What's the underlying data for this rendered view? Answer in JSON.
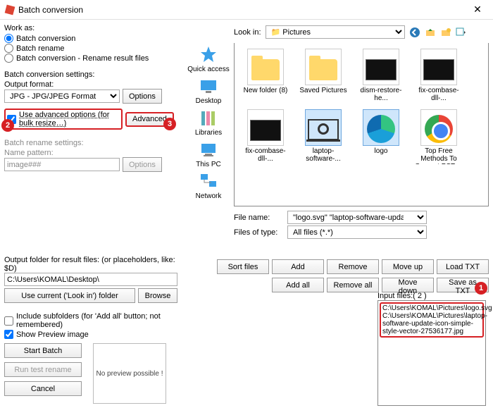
{
  "window": {
    "title": "Batch conversion"
  },
  "work_as": {
    "label": "Work as:",
    "options": [
      {
        "label": "Batch conversion",
        "checked": true
      },
      {
        "label": "Batch rename",
        "checked": false
      },
      {
        "label": "Batch conversion - Rename result files",
        "checked": false
      }
    ]
  },
  "batch_settings": {
    "heading": "Batch conversion settings:",
    "output_format_label": "Output format:",
    "output_format_value": "JPG - JPG/JPEG Format",
    "options_btn": "Options",
    "advanced_check": "Use advanced options (for bulk resize…)",
    "advanced_btn": "Advanced"
  },
  "rename_settings": {
    "heading": "Batch rename settings:",
    "name_pattern_label": "Name pattern:",
    "name_pattern_value": "image###",
    "options_btn": "Options"
  },
  "output_folder": {
    "label": "Output folder for result files: (or placeholders, like: $D)",
    "path": "C:\\Users\\KOMAL\\Desktop\\",
    "use_current_btn": "Use current ('Look in') folder",
    "browse_btn": "Browse",
    "include_sub": "Include subfolders (for 'Add all' button; not remembered)",
    "show_preview": "Show Preview image",
    "start_btn": "Start Batch",
    "runtest_btn": "Run test rename",
    "cancel_btn": "Cancel",
    "no_preview": "No preview possible !"
  },
  "lookin": {
    "label": "Look in:",
    "value": "Pictures"
  },
  "places": [
    {
      "label": "Quick access"
    },
    {
      "label": "Desktop"
    },
    {
      "label": "Libraries"
    },
    {
      "label": "This PC"
    },
    {
      "label": "Network"
    }
  ],
  "thumbs": [
    {
      "label": "New folder (8)",
      "type": "folder"
    },
    {
      "label": "Saved Pictures",
      "type": "folder"
    },
    {
      "label": "dism-restore-he...",
      "type": "screenshot"
    },
    {
      "label": "fix-combase-dll-...",
      "type": "screenshot"
    },
    {
      "label": "fix-combase-dll-...",
      "type": "screenshot"
    },
    {
      "label": "laptop-software-...",
      "type": "laptop",
      "selected": true
    },
    {
      "label": "logo",
      "type": "edge",
      "selected": true
    },
    {
      "label": "Top Free Methods To Convert PST ...",
      "type": "chrome"
    }
  ],
  "file_row": {
    "name_label": "File name:",
    "name_value": "\"logo.svg\" \"laptop-software-update-icon-simple",
    "type_label": "Files of type:",
    "type_value": "All files (*.*)"
  },
  "actions": {
    "sort": "Sort files",
    "add": "Add",
    "remove": "Remove",
    "moveup": "Move up",
    "loadtxt": "Load TXT",
    "addall": "Add all",
    "removeall": "Remove all",
    "movedown": "Move down",
    "savetxt": "Save as TXT"
  },
  "input_files": {
    "label": "Input files:( 2 )",
    "items": [
      "C:\\Users\\KOMAL\\Pictures\\logo.svg",
      "C:\\Users\\KOMAL\\Pictures\\laptop-software-update-icon-simple-style-vector-27536177.jpg"
    ]
  },
  "badges": {
    "one": "1",
    "two": "2",
    "three": "3"
  }
}
